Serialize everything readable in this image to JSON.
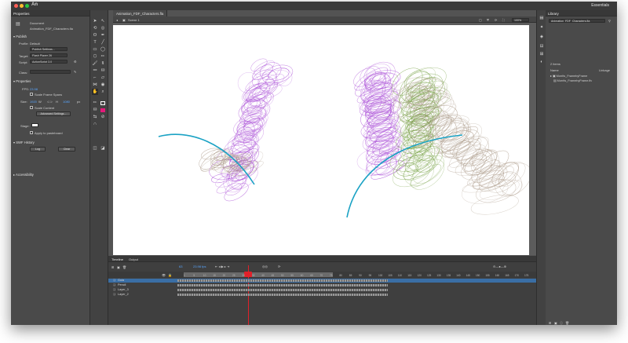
{
  "app": {
    "logo": "An",
    "workspace": "Essentials"
  },
  "document_tab": "Animation_FDF_Characters.fla",
  "scene": "Scene 1",
  "zoom": "100%",
  "properties_panel": {
    "title": "Properties",
    "doc_type": "Document",
    "doc_name": "Animation_FDF_Characters.fla",
    "publish_section": "Publish",
    "profile_label": "Profile:",
    "profile_value": "Default",
    "publish_settings_button": "Publish Settings...",
    "target_label": "Target:",
    "target_value": "Flash Player 26",
    "script_label": "Script:",
    "script_value": "ActionScript 3.0",
    "class_label": "Class:",
    "class_value": "",
    "properties_section": "Properties",
    "fps_label": "FPS:",
    "fps_value": "23.98",
    "scale_frame_spans_label": "Scale Frame Spans",
    "size_label": "Size:",
    "width_value": "1920",
    "w_label": "W",
    "height_value": "1080",
    "h_label": "H",
    "unit_value": "px",
    "scale_content_label": "Scale Content",
    "advanced_settings_button": "Advanced Settings...",
    "stage_label": "Stage:",
    "apply_pasteboard_label": "Apply to pasteboard",
    "swf_history_section": "SWF History",
    "log_button": "Log",
    "clear_button": "Clear",
    "accessibility_section": "Accessibility"
  },
  "library_panel": {
    "title": "Library",
    "library_file": "Animation_FDF_Characters.fla",
    "item_count": "2 items",
    "col_name": "Name",
    "col_linkage": "Linkage",
    "items": [
      {
        "name": "Morrits_FramebyFrame"
      },
      {
        "name": "Morrits_FramebyFrame.flv"
      }
    ]
  },
  "timeline": {
    "tab_timeline": "Timeline",
    "tab_output": "Output",
    "current_frame": "63",
    "fps_display": "23.98 fps",
    "time_display": "2.6s",
    "frame_numbers": [
      "1",
      "5",
      "10",
      "15",
      "20",
      "25",
      "30",
      "35",
      "40",
      "45",
      "50",
      "55",
      "60",
      "65",
      "70",
      "75",
      "80",
      "85",
      "90",
      "95",
      "100",
      "105",
      "110",
      "115",
      "120",
      "125",
      "130",
      "135",
      "140",
      "145",
      "150",
      "155",
      "160",
      "165",
      "170",
      "175"
    ],
    "layers": [
      {
        "name": "Guia",
        "selected": true
      },
      {
        "name": "Pencil",
        "selected": false
      },
      {
        "name": "Layer_3",
        "selected": false
      },
      {
        "name": "Layer_2",
        "selected": false
      }
    ]
  },
  "colors": {
    "accent_blue": "#1f6fbf",
    "layer_blue_highlight": "#3a6ea5",
    "playhead_red": "#e0202a",
    "fill_magenta": "#e4197a",
    "stroke_teal": "#1aa2c4",
    "sketch_purple": "#a84ad6",
    "sketch_green": "#6f9c3a",
    "sketch_brown": "#a89684"
  }
}
